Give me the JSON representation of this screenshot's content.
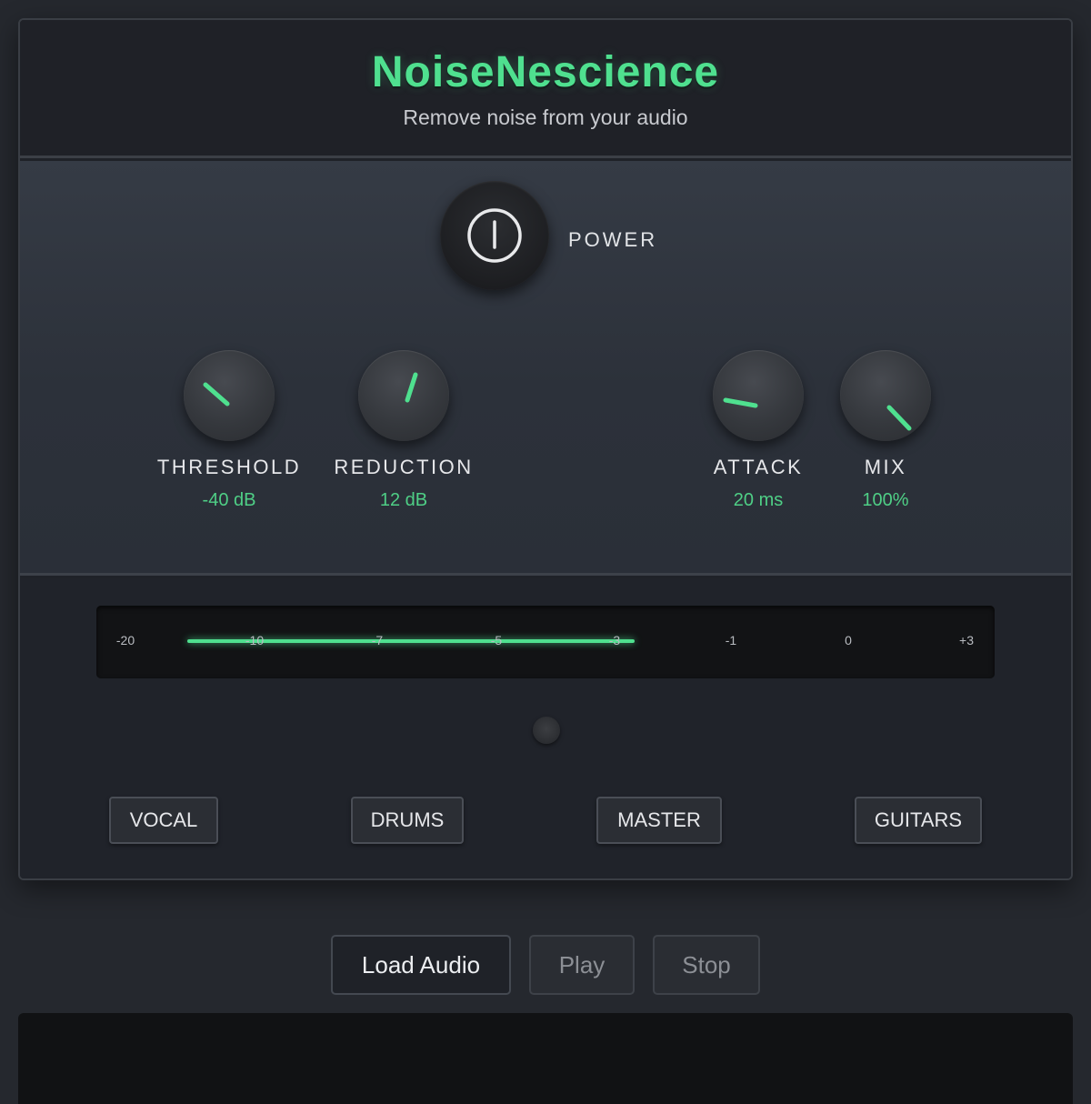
{
  "app": {
    "title": "NoiseNescience",
    "subtitle": "Remove noise from your audio"
  },
  "power": {
    "label": "POWER",
    "icon": "power-icon"
  },
  "knobs": [
    {
      "label": "THRESHOLD",
      "value": "-40 dB"
    },
    {
      "label": "REDUCTION",
      "value": "12 dB"
    },
    {
      "label": "ATTACK",
      "value": "20 ms"
    },
    {
      "label": "MIX",
      "value": "100%"
    }
  ],
  "meter": {
    "ticks": [
      "-20",
      "-10",
      "-7",
      "-5",
      "-3",
      "-1",
      "0",
      "+3"
    ],
    "color": "#4fe08f"
  },
  "presets": [
    "VOCAL",
    "DRUMS",
    "MASTER",
    "GUITARS"
  ],
  "transport": {
    "load": "Load Audio",
    "play": "Play",
    "stop": "Stop"
  },
  "colors": {
    "accent": "#4fe08f",
    "value_text": "#4fcf86",
    "background": "#25282e"
  }
}
